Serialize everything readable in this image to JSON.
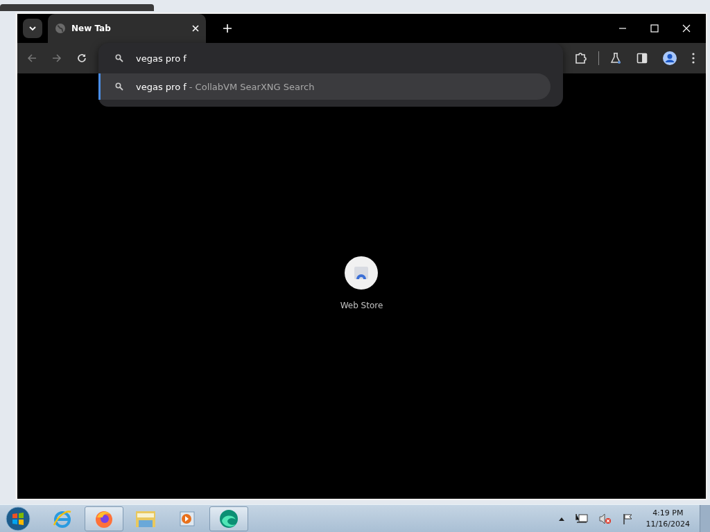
{
  "browser": {
    "tabs": [
      {
        "title": "New Tab",
        "selected": true
      }
    ],
    "omnibox": {
      "value": "vegas pro f"
    },
    "suggestions": [
      {
        "query": "vegas pro f",
        "source": "- CollabVM SearXNG Search",
        "selected": true
      }
    ],
    "shortcuts": [
      {
        "label": "Web Store"
      }
    ]
  },
  "taskbar": {
    "apps": [
      {
        "kind": "ie",
        "active": false
      },
      {
        "kind": "firefox",
        "active": true
      },
      {
        "kind": "folder",
        "active": false
      },
      {
        "kind": "media",
        "active": false
      },
      {
        "kind": "edge",
        "active": true
      }
    ],
    "clock": {
      "time": "4:19 PM",
      "date": "11/16/2024"
    }
  }
}
